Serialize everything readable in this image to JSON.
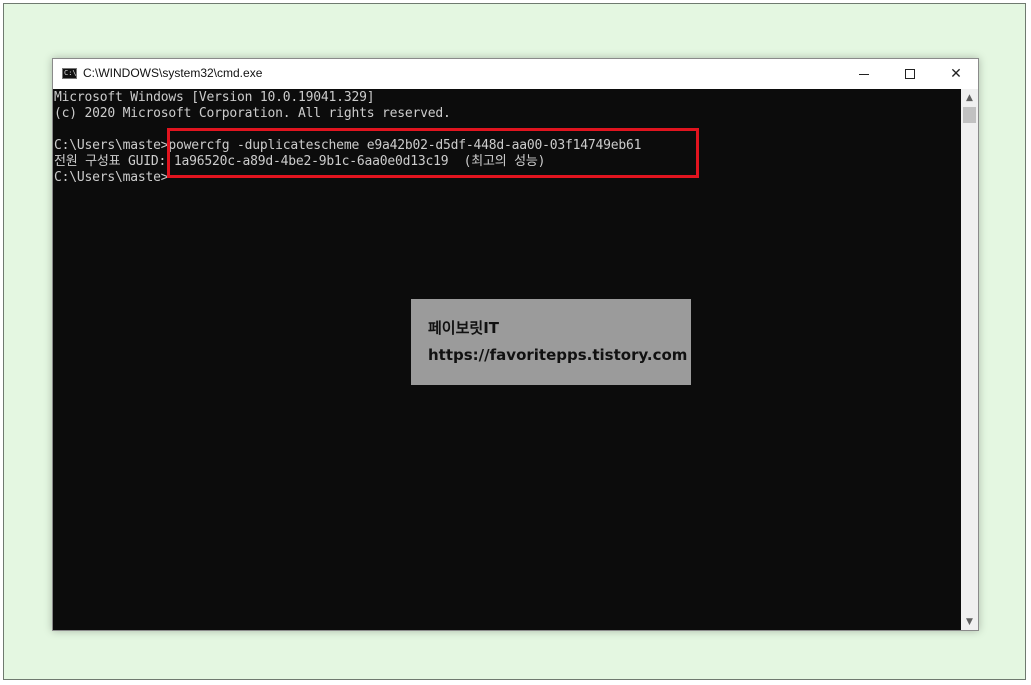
{
  "window": {
    "title": "C:\\WINDOWS\\system32\\cmd.exe",
    "icon": "cmd-icon",
    "icon_glyph": "C:\\",
    "controls": {
      "minimize_icon": "minimize-icon",
      "maximize_icon": "maximize-icon",
      "close_glyph": "✕"
    }
  },
  "console": {
    "lines": [
      "Microsoft Windows [Version 10.0.19041.329]",
      "(c) 2020 Microsoft Corporation. All rights reserved.",
      "C:\\Users\\maste>powercfg -duplicatescheme e9a42b02-d5df-448d-aa00-03f14749eb61",
      "전원 구성표 GUID: 1a96520c-a89d-4be2-9b1c-6aa0e0d13c19  (최고의 성능)",
      "C:\\Users\\maste>"
    ],
    "text_color": "#cccccc",
    "background": "#0c0c0c"
  },
  "highlight": {
    "color": "#e1141f"
  },
  "scrollbar": {
    "up_glyph": "▲",
    "down_glyph": "▼"
  },
  "watermark": {
    "name": "페이보릿IT",
    "url": "https://favoritepps.tistory.com"
  }
}
